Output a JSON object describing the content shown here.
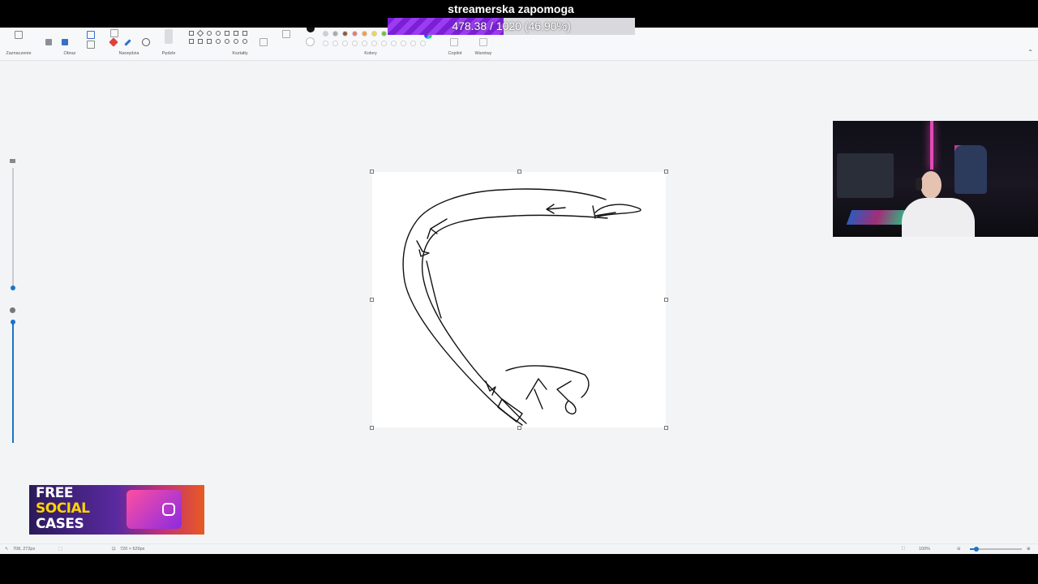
{
  "stream_goal": {
    "title": "streamerska zapomoga",
    "progress_text": "478.38 / 1020 (46.90%)",
    "progress_fraction": 0.469
  },
  "ribbon": {
    "groups": {
      "selection": "Zaznaczenie",
      "image": "Obraz",
      "tools": "Narzędzia",
      "brushes": "Pędzle",
      "shapes": "Kształty",
      "colors": "Kolory",
      "copilot": "Copilot",
      "layers": "Warstwy"
    },
    "palette_row1": [
      "#cfcfd4",
      "#a8a8ad",
      "#8a5a3c",
      "#e87878",
      "#f0a040",
      "#f0d840",
      "#70c040"
    ],
    "palette_row2": [
      "#ffffff",
      "#ffffff",
      "#ffffff",
      "#ffffff",
      "#ffffff",
      "#ffffff",
      "#ffffff",
      "#ffffff",
      "#ffffff",
      "#ffffff",
      "#ffffff"
    ]
  },
  "status_bar": {
    "cursor_position": "708, 272px",
    "canvas_size": "720 × 629px",
    "zoom": "100%"
  },
  "ad": {
    "line1": "FREE",
    "line2": "SOCIAL",
    "line3": "CASES"
  },
  "colors": {
    "accent": "#1a73c8",
    "goal_fill": "#8a2be2",
    "app_background": "#f3f4f6"
  }
}
